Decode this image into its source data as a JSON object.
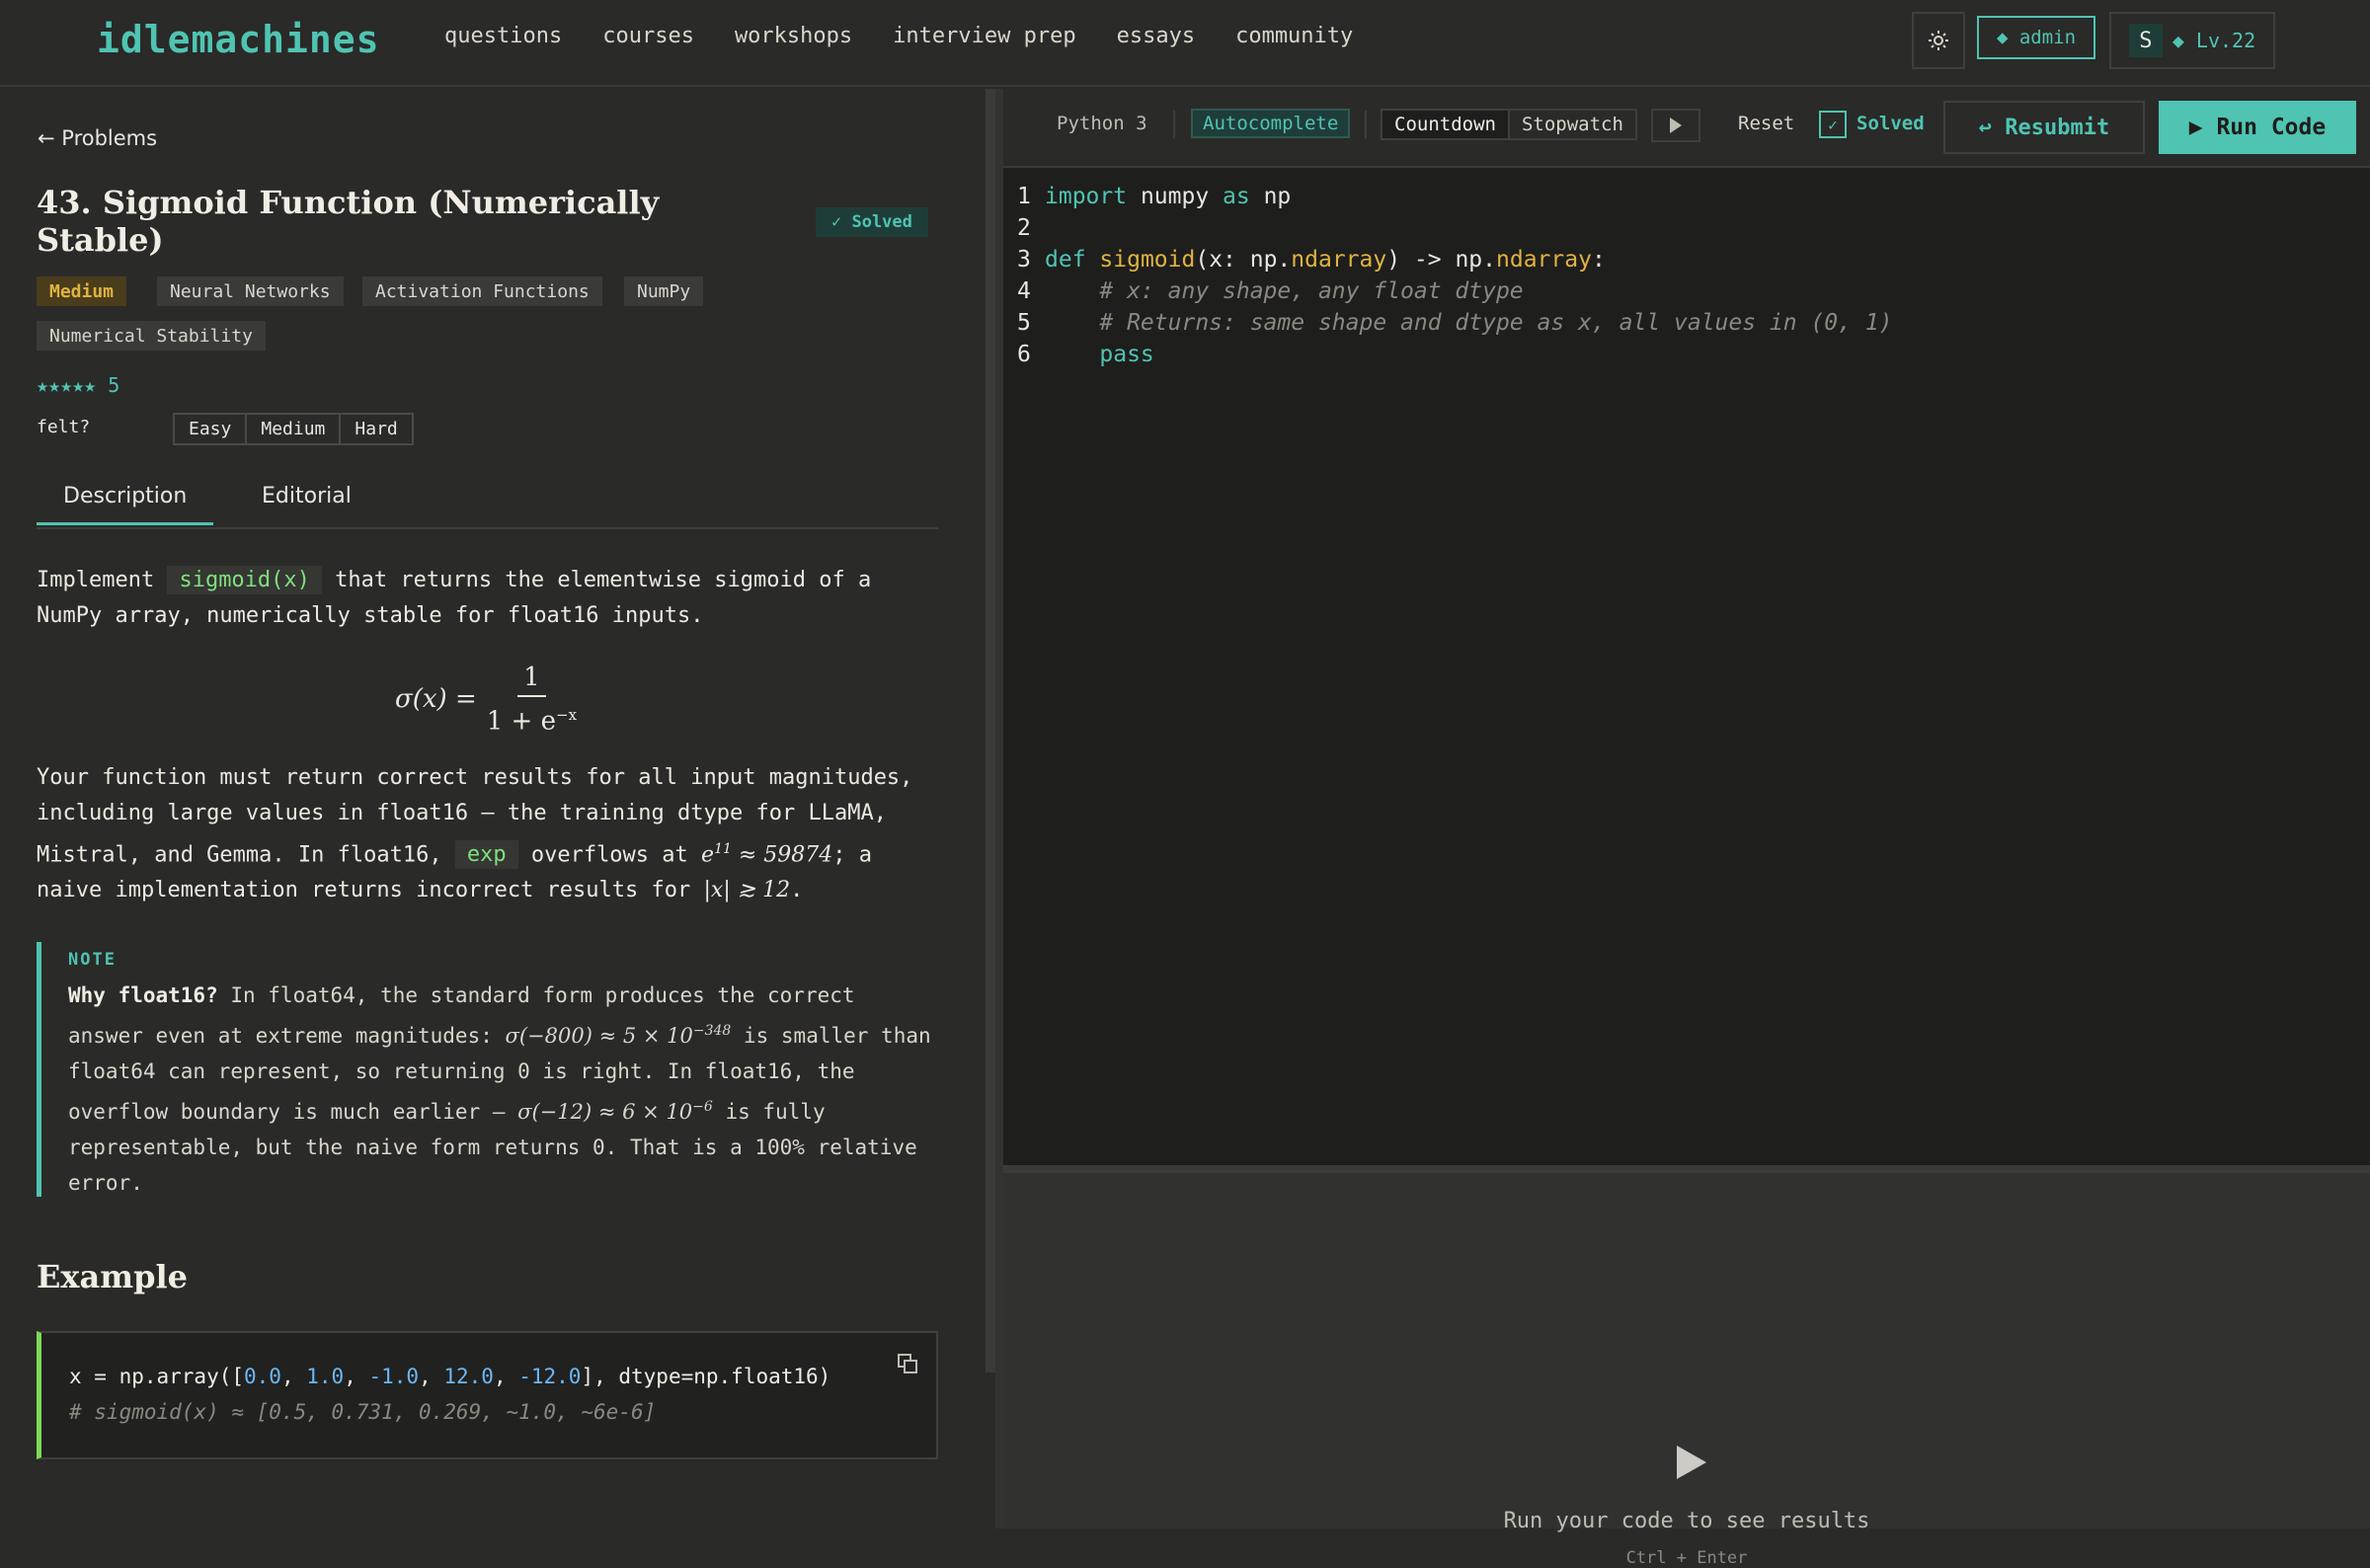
{
  "header": {
    "logo": "idlemachines",
    "nav": [
      "questions",
      "courses",
      "workshops",
      "interview prep",
      "essays",
      "community"
    ],
    "theme_icon": "sun-icon",
    "admin_label": "◆ admin",
    "avatar_initial": "S",
    "level_label": "◆ Lv.22"
  },
  "problem": {
    "back_label": "← Problems",
    "title": "43. Sigmoid Function (Numerically Stable)",
    "solved_badge": "✓ Solved",
    "difficulty": "Medium",
    "tags": [
      "Neural Networks",
      "Activation Functions",
      "NumPy",
      "Numerical Stability"
    ],
    "stars": "★★★★★ 5",
    "felt_label": "felt?",
    "felt_options": [
      "Easy",
      "Medium",
      "Hard"
    ],
    "tabs": [
      "Description",
      "Editorial"
    ],
    "intro_1": "Implement ",
    "intro_code": "sigmoid(x)",
    "intro_2": " that returns the elementwise sigmoid of a NumPy array, numerically stable for float16 inputs.",
    "formula_lhs": "σ(x) =",
    "formula_num": "1",
    "formula_den": "1 + e",
    "formula_den_exp": "−x",
    "p2_a": "Your function must return correct results for all input magnitudes, including large values in float16 — the training dtype for LLaMA, Mistral, and Gemma. In float16, ",
    "p2_code": "exp",
    "p2_b": " overflows at ",
    "p2_math1": "e",
    "p2_math1_exp": "11",
    "p2_math2": " ≈ 59874",
    "p2_c": "; a naive implementation returns incorrect results for ",
    "p2_math3": "|x| ≳ 12",
    "p2_d": ".",
    "note_label": "NOTE",
    "note_bold": "Why float16?",
    "note_1": " In float64, the standard form produces the correct answer even at extreme magnitudes: ",
    "note_m1": "σ(−800) ≈ 5 × 10",
    "note_m1_exp": "−348",
    "note_2": " is smaller than float64 can represent, so returning 0 is right. In float16, the overflow boundary is much earlier — ",
    "note_m2": "σ(−12) ≈ 6 × 10",
    "note_m2_exp": "−6",
    "note_3": " is fully representable, but the naive form returns 0. That is a 100% relative error.",
    "example_heading": "Example",
    "example_comment": "# sigmoid(x) ≈ [0.5, 0.731, 0.269, ~1.0, ~6e-6]"
  },
  "toolbar": {
    "language": "Python 3",
    "autocomplete": "Autocomplete",
    "countdown": "Countdown",
    "stopwatch": "Stopwatch",
    "reset": "Reset",
    "solved": "Solved",
    "resubmit": "↩ Resubmit",
    "run": "▶ Run Code"
  },
  "output": {
    "hint": "Run your code to see results",
    "shortcut": "Ctrl + Enter"
  },
  "colors": {
    "accent": "#4fc4b2",
    "medium": "#e0b340",
    "inline_code": "#7ee07e"
  }
}
